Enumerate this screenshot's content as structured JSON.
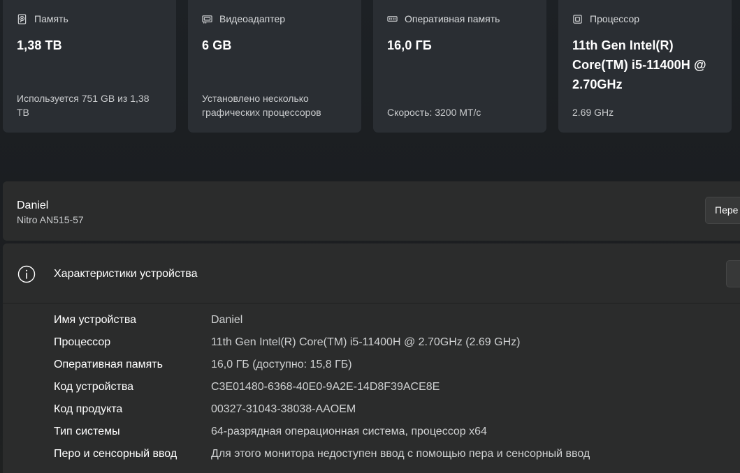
{
  "cards": [
    {
      "icon": "storage-icon",
      "title": "Память",
      "value": "1,38 TB",
      "sub": "Используется 751 GB из 1,38 TB"
    },
    {
      "icon": "gpu-icon",
      "title": "Видеоадаптер",
      "value": "6 GB",
      "sub": "Установлено несколько графических процессоров"
    },
    {
      "icon": "ram-icon",
      "title": "Оперативная память",
      "value": "16,0 ГБ",
      "sub": "Скорость: 3200 MT/с"
    },
    {
      "icon": "cpu-icon",
      "title": "Процессор",
      "value": "11th Gen Intel(R) Core(TM) i5-11400H @ 2.70GHz",
      "sub": "2.69 GHz"
    }
  ],
  "device": {
    "name": "Daniel",
    "model": "Nitro AN515-57",
    "rename_label": "Пере"
  },
  "specs": {
    "title": "Характеристики устройства",
    "rows": [
      {
        "label": "Имя устройства",
        "value": "Daniel"
      },
      {
        "label": "Процессор",
        "value": "11th Gen Intel(R) Core(TM) i5-11400H @ 2.70GHz (2.69 GHz)"
      },
      {
        "label": "Оперативная память",
        "value": "16,0 ГБ (доступно: 15,8 ГБ)"
      },
      {
        "label": "Код устройства",
        "value": "C3E01480-6368-40E0-9A2E-14D8F39ACE8E"
      },
      {
        "label": "Код продукта",
        "value": "00327-31043-38038-AAOEM"
      },
      {
        "label": "Тип системы",
        "value": "64-разрядная операционная система, процессор x64"
      },
      {
        "label": "Перо и сенсорный ввод",
        "value": "Для этого монитора недоступен ввод с помощью пера и сенсорный ввод"
      }
    ]
  }
}
